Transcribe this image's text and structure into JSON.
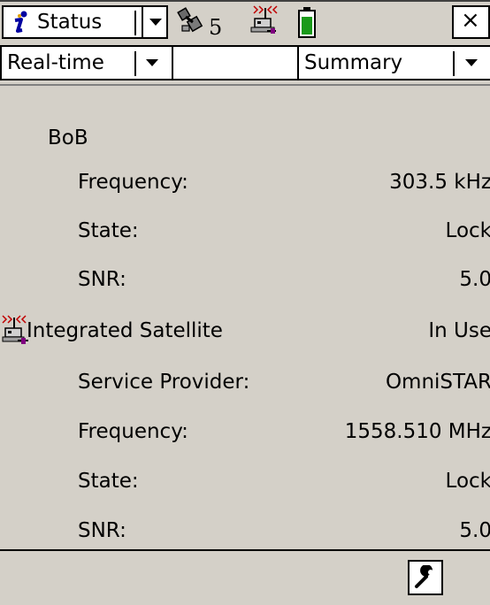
{
  "titlebar": {
    "app_label": "Status",
    "satellites_count": "5",
    "close_label": "×"
  },
  "toolbar": {
    "left_select_value": "Real-time",
    "right_select_value": "Summary"
  },
  "rows": [
    {
      "label": "BoB",
      "value": ""
    },
    {
      "label": "Frequency:",
      "value": "303.5 kHz"
    },
    {
      "label": "State:",
      "value": "Lock"
    },
    {
      "label": "SNR:",
      "value": "5.0"
    },
    {
      "label": "Integrated Satellite",
      "value": "In Use"
    },
    {
      "label": "Service Provider:",
      "value": "OmniSTAR"
    },
    {
      "label": "Frequency:",
      "value": "1558.510 MHz"
    },
    {
      "label": "State:",
      "value": "Lock"
    },
    {
      "label": "SNR:",
      "value": "5.0"
    }
  ],
  "icons": {
    "app": "info-icon",
    "satellites": "satellite-icon",
    "radio": "radio-receiver-icon",
    "battery": "battery-icon",
    "wrench": "wrench-icon"
  },
  "colors": {
    "background": "#d4d0c8",
    "battery_fill": "#1a9a1a",
    "accent_blue": "#0000a0",
    "signal_red": "#c00000",
    "marker_purple": "#800080"
  }
}
